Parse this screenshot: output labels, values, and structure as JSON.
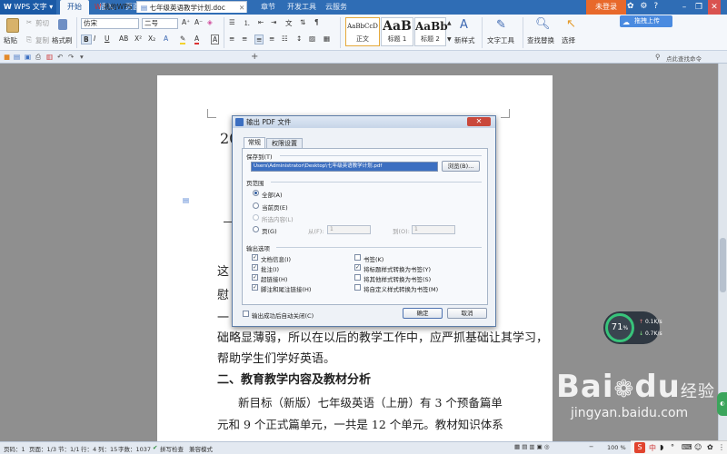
{
  "app": {
    "name": "WPS 文字",
    "menu_tabs": [
      "开始",
      "插入",
      "页面布局",
      "引用",
      "审阅",
      "视图",
      "章节",
      "开发工具",
      "云服务"
    ],
    "active_menu_tab": "开始",
    "login_label": "未登录",
    "upload_label": "拖拽上传"
  },
  "ribbon": {
    "paste": "粘贴",
    "cut": "剪切",
    "copy": "复制",
    "format_painter": "格式刷",
    "font_name": "仿宋",
    "font_size": "二号",
    "style_normal_preview": "AaBbCcD",
    "style_normal": "正文",
    "style_h1_preview": "AaB",
    "style_h1": "标题 1",
    "style_h2_preview": "AaBb",
    "style_h2": "标题 2",
    "new_style": "新样式",
    "text_tools": "文字工具",
    "find_replace": "查找替换",
    "select": "选择",
    "search_commands": "点此查找命令"
  },
  "tabs": {
    "my_wps": "我的WPS",
    "doc_name": "七年级英语教学计划.doc"
  },
  "document": {
    "year_fragment": "20",
    "line1": "这",
    "line2": "慰",
    "line3": "一",
    "line4": "础略显薄弱，所以在以后的教学工作中，应严抓基础让其学习，",
    "line5": "帮助学生们学好英语。",
    "heading2": "二、教育教学内容及教材分析",
    "para2_l1": "新目标（新版）七年级英语（上册）有 3 个预备篇单",
    "para2_l2": "元和 9 个正式篇单元，一共是 12 个单元。教材知识体系"
  },
  "dialog": {
    "title": "输出 PDF 文件",
    "tab_general": "常规",
    "tab_permissions": "权限设置",
    "save_to_label": "保存到(T)",
    "save_path": "Users\\Administrator\\Desktop\\七年级英语教学计划.pdf",
    "browse": "浏览(B)...",
    "range_label": "页范围",
    "range_all": "全部(A)",
    "range_current": "当前页(E)",
    "range_selection": "所选内容(L)",
    "range_pages": "页(G)",
    "from_label": "从(F):",
    "from_value": "1",
    "to_label": "到(O):",
    "to_value": "1",
    "options_label": "输出选项",
    "opt_doc_info": "文档信息(I)",
    "opt_comments": "批注(I)",
    "opt_hyperlinks": "超链接(H)",
    "opt_footnotes": "脚注和尾注链接(H)",
    "opt_bookmarks": "书签(K)",
    "opt_heading_bookmarks": "将标题样式转换为书签(Y)",
    "opt_other_bookmarks": "将其他样式转换为书签(S)",
    "opt_custom_bookmarks": "将自定义样式转换为书签(M)",
    "auto_close": "输出成功后自动关闭(C)",
    "ok": "确定",
    "cancel": "取消"
  },
  "speed_widget": {
    "percent": "71",
    "up": "0.1K/s",
    "down": "0.7K/s"
  },
  "statusbar": {
    "page_no": "页码：1",
    "pages": "页面：1/3",
    "section": "节：1/1",
    "row": "行：4",
    "col": "列：15",
    "words": "字数：1037",
    "spell": "拼写检查",
    "compat": "兼容模式",
    "zoom": "100 %"
  },
  "watermark": {
    "main": "Bai",
    "paw": "du",
    "sub": "jingyan.baidu.com",
    "jingyan": "经验"
  }
}
